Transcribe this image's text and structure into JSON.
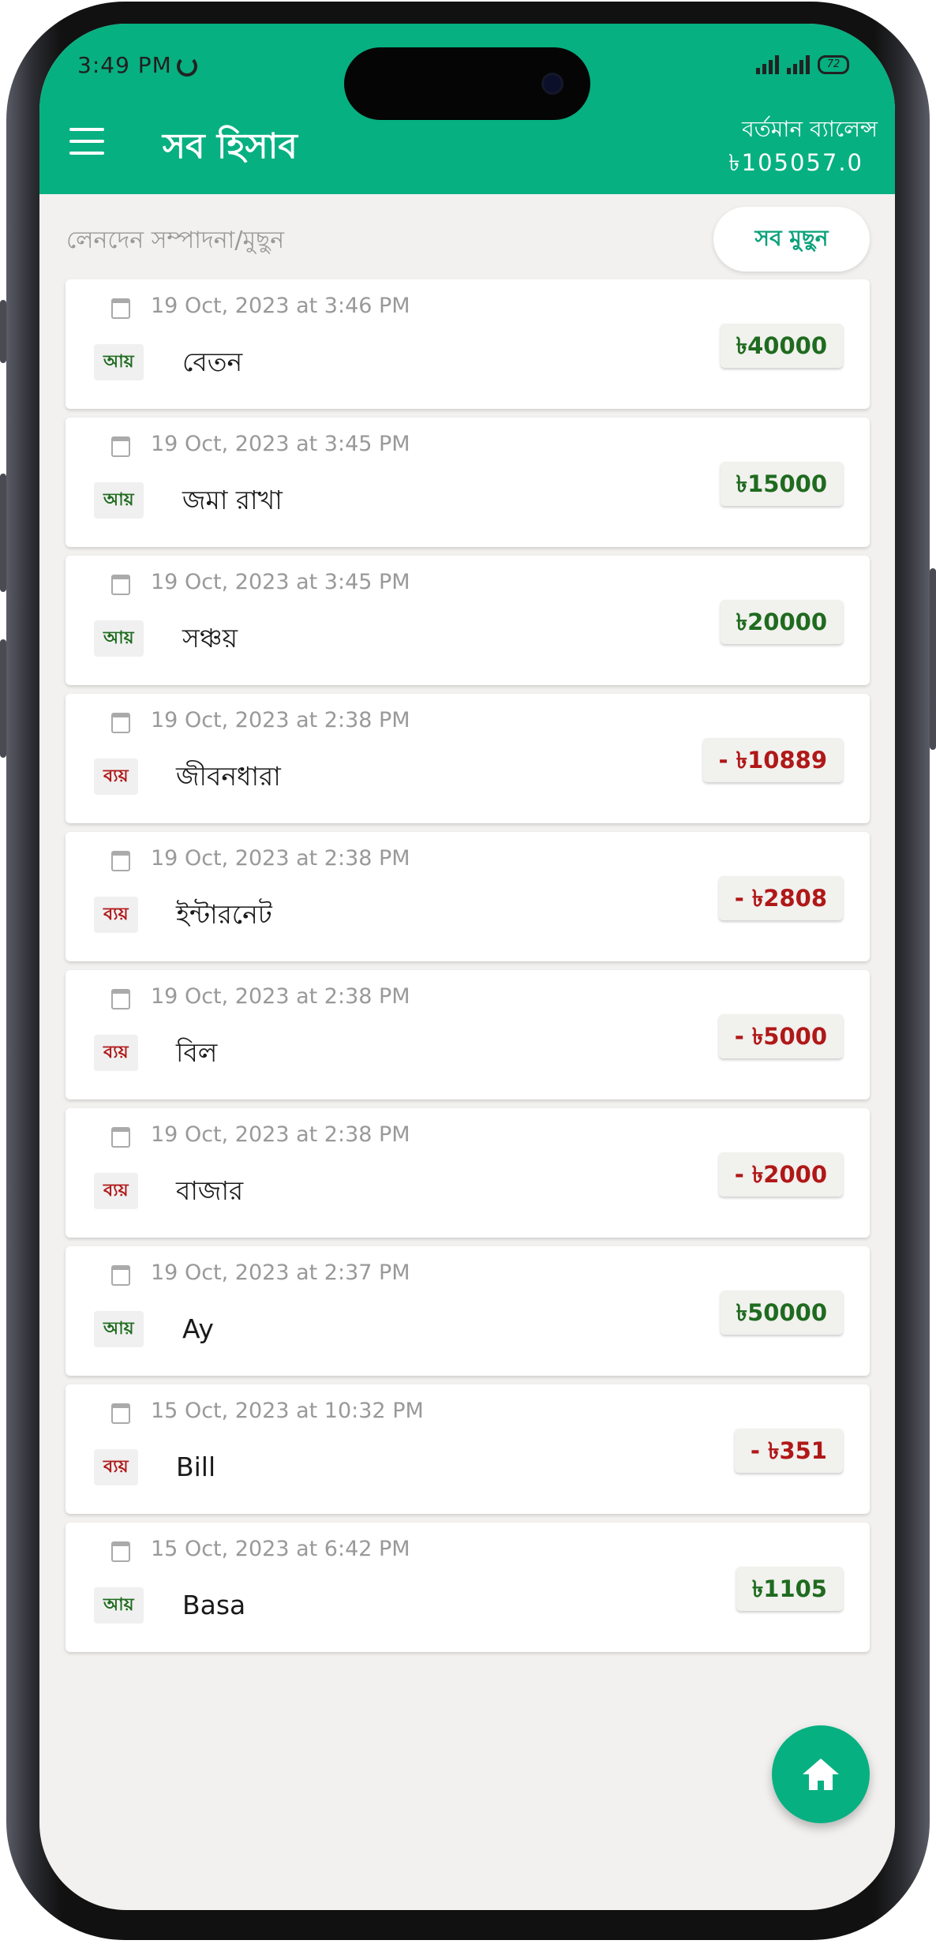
{
  "status_bar": {
    "time": "3:49 PM",
    "battery": "72"
  },
  "header": {
    "menu_icon": "hamburger-menu-icon",
    "title": "সব হিসাব",
    "balance_label": "বর্তমান ব্যালেন্স",
    "balance_value": "৳105057.0"
  },
  "subheader": {
    "label": "লেনদেন সম্পাদনা/মুছুন",
    "delete_all_label": "সব মুছুন"
  },
  "colors": {
    "primary": "#07b081",
    "income": "#1f6b1f",
    "expense": "#b01818"
  },
  "transactions": [
    {
      "date": "19 Oct, 2023 at 3:46 PM",
      "type": "income",
      "type_label": "আয়",
      "description": "বেতন",
      "amount": "৳40000"
    },
    {
      "date": "19 Oct, 2023 at 3:45 PM",
      "type": "income",
      "type_label": "আয়",
      "description": "জমা রাখা",
      "amount": "৳15000"
    },
    {
      "date": "19 Oct, 2023 at 3:45 PM",
      "type": "income",
      "type_label": "আয়",
      "description": "সঞ্চয়",
      "amount": "৳20000"
    },
    {
      "date": "19 Oct, 2023 at 2:38 PM",
      "type": "expense",
      "type_label": "ব্যয়",
      "description": "জীবনধারা",
      "amount": "- ৳10889"
    },
    {
      "date": "19 Oct, 2023 at 2:38 PM",
      "type": "expense",
      "type_label": "ব্যয়",
      "description": "ইন্টারনেট",
      "amount": "- ৳2808"
    },
    {
      "date": "19 Oct, 2023 at 2:38 PM",
      "type": "expense",
      "type_label": "ব্যয়",
      "description": "বিল",
      "amount": "- ৳5000"
    },
    {
      "date": "19 Oct, 2023 at 2:38 PM",
      "type": "expense",
      "type_label": "ব্যয়",
      "description": "বাজার",
      "amount": "- ৳2000"
    },
    {
      "date": "19 Oct, 2023 at 2:37 PM",
      "type": "income",
      "type_label": "আয়",
      "description": "Ay",
      "amount": "৳50000"
    },
    {
      "date": "15 Oct, 2023 at 10:32 PM",
      "type": "expense",
      "type_label": "ব্যয়",
      "description": "Bill",
      "amount": "- ৳351"
    },
    {
      "date": "15 Oct, 2023 at 6:42 PM",
      "type": "income",
      "type_label": "আয়",
      "description": "Basa",
      "amount": "৳1105"
    }
  ],
  "fab": {
    "icon": "home-icon"
  }
}
